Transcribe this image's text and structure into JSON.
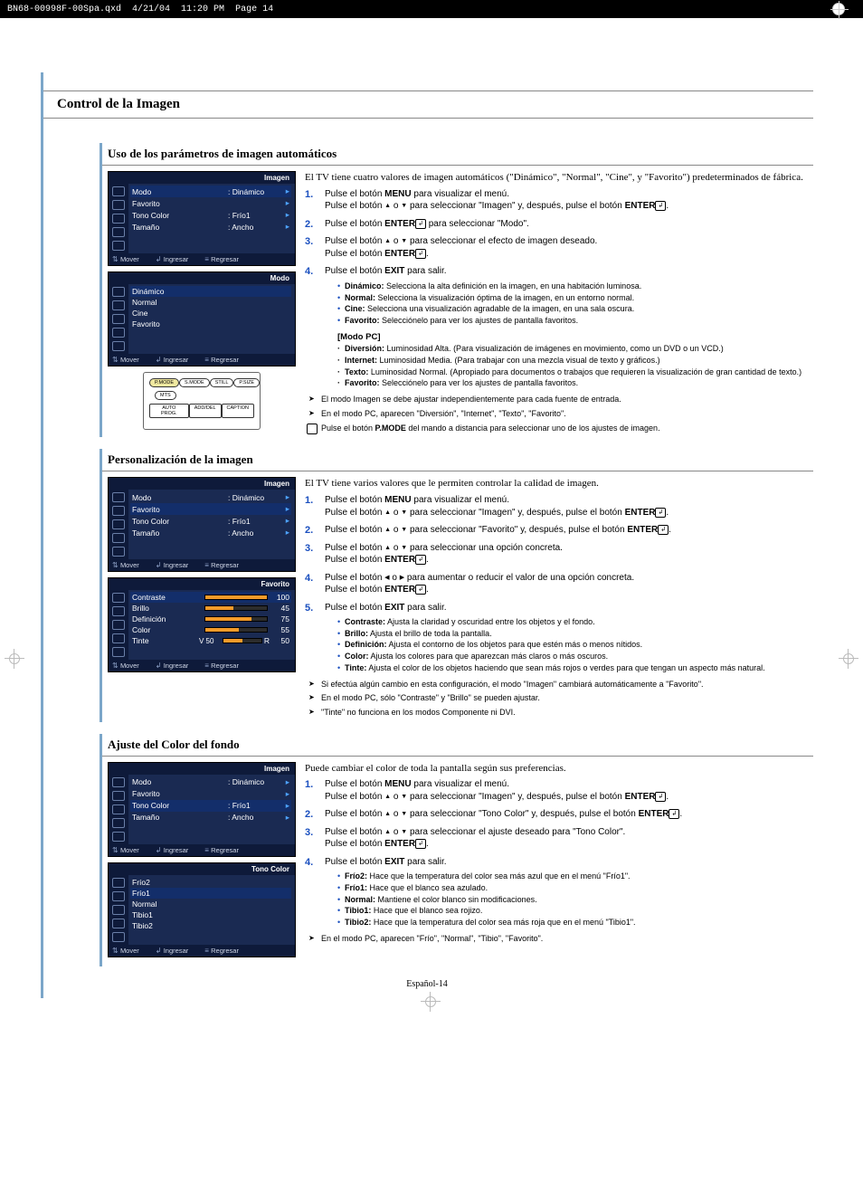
{
  "header": {
    "file": "BN68-00998F-00Spa.qxd",
    "date": "4/21/04",
    "time": "11:20 PM",
    "page_label": "Page 14"
  },
  "main_title": "Control de la Imagen",
  "page_number": "Español-14",
  "osd_common": {
    "imagen_title": "Imagen",
    "mover": "Mover",
    "ingresar": "Ingresar",
    "regresar": "Regresar",
    "rows": {
      "modo": "Modo",
      "modo_val": ":  Dinámico",
      "favorito": "Favorito",
      "tono": "Tono Color",
      "tono_val": ":  Frío1",
      "tamano": "Tamaño",
      "tamano_val": ":  Ancho"
    }
  },
  "s1": {
    "heading": "Uso de los parámetros de imagen automáticos",
    "osd_modo_title": "Modo",
    "modo_items": [
      "Dinámico",
      "Normal",
      "Cine",
      "Favorito"
    ],
    "intro": "El TV tiene cuatro valores de imagen automáticos (\"Dinámico\", \"Normal\", \"Cine\", y \"Favorito\") predeterminados de fábrica.",
    "step1a": "Pulse el botón ",
    "step1b_kw": "MENU",
    "step1c": " para visualizar el menú.",
    "step1d": "Pulse el botón ",
    "step1e": " o ",
    "step1f": " para seleccionar \"Imagen\" y, después, pulse el botón ",
    "step1g_kw": "ENTER",
    "step1h": ".",
    "step2a": "Pulse el botón ",
    "step2b_kw": "ENTER",
    "step2c": " para seleccionar \"Modo\".",
    "step3a": "Pulse el botón ",
    "step3b": " o ",
    "step3c": " para seleccionar el efecto de imagen deseado.",
    "step3d": "Pulse el botón ",
    "step3e_kw": "ENTER",
    "step3f": ".",
    "step4a": "Pulse el botón ",
    "step4b_kw": "EXIT",
    "step4c": " para salir.",
    "def": [
      {
        "t": "Dinámico:",
        "d": " Selecciona la alta definición en la imagen, en una habitación luminosa."
      },
      {
        "t": "Normal:",
        "d": " Selecciona la visualización óptima de la imagen, en un entorno normal."
      },
      {
        "t": "Cine:",
        "d": " Selecciona una visualización agradable de la imagen, en una sala oscura."
      },
      {
        "t": "Favorito:",
        "d": " Selecciónelo para ver los ajustes de pantalla favoritos."
      }
    ],
    "modo_pc_hdr": "[Modo PC]",
    "pc_items": [
      {
        "t": "Diversión:",
        "d": " Luminosidad Alta. (Para visualización de imágenes en movimiento, como un DVD o un VCD.)"
      },
      {
        "t": "Internet:",
        "d": " Luminosidad Media. (Para trabajar con una mezcla visual de texto y gráficos.)"
      },
      {
        "t": "Texto:",
        "d": " Luminosidad Normal. (Apropiado para documentos o trabajos que requieren la visualización de gran cantidad de texto.)"
      },
      {
        "t": "Favorito:",
        "d": " Selecciónelo para ver los ajustes de pantalla favoritos."
      }
    ],
    "note1": "El modo Imagen se debe ajustar independientemente para cada fuente de entrada.",
    "note2": "En el modo PC, aparecen \"Diversión\", \"Internet\", \"Texto\", \"Favorito\".",
    "hand_a": "Pulse el botón ",
    "hand_kw": "P.MODE",
    "hand_b": " del mando a distancia para seleccionar uno de los ajustes de imagen.",
    "remote_btns": {
      "r1": [
        "P.MODE",
        "S.MODE",
        "STILL",
        "P.SIZE"
      ],
      "r2": [
        "MTS"
      ],
      "r3": [
        "AUTO PROG.",
        "ADD/DEL",
        "CAPTION"
      ]
    }
  },
  "s2": {
    "heading": "Personalización de la imagen",
    "osd_fav_title": "Favorito",
    "sliders": [
      {
        "name": "Contraste",
        "val": "100",
        "fill": 100
      },
      {
        "name": "Brillo",
        "val": "45",
        "fill": 45
      },
      {
        "name": "Definición",
        "val": "75",
        "fill": 75
      },
      {
        "name": "Color",
        "val": "55",
        "fill": 55
      },
      {
        "name": "Tinte",
        "prefix": "V  50",
        "val": "50",
        "suffix": "R",
        "fill": 50
      }
    ],
    "intro": "El TV tiene varios valores que le permiten controlar la calidad de imagen.",
    "step2": "Pulse el botón ▲ o ▼ para seleccionar \"Favorito\" y, después, pulse el botón ENTER.",
    "step3a": "Pulse el botón ",
    "step3b": " o ",
    "step3c": " para seleccionar una opción concreta.",
    "step4a": "Pulse el botón ",
    "step4b": " o ",
    "step4c": " para aumentar o reducir el valor de una opción concreta.",
    "step5a": "Pulse el botón ",
    "step5b_kw": "EXIT",
    "step5c": " para salir.",
    "defs": [
      {
        "t": "Contraste:",
        "d": " Ajusta la claridad y oscuridad entre los objetos y el fondo."
      },
      {
        "t": "Brillo:",
        "d": " Ajusta el brillo de toda la pantalla."
      },
      {
        "t": "Definición:",
        "d": " Ajusta el contorno de los objetos para que estén más o menos nítidos."
      },
      {
        "t": "Color:",
        "d": " Ajusta los colores para que aparezcan más claros o más oscuros."
      },
      {
        "t": "Tinte:",
        "d": " Ajusta el color de los objetos haciendo que sean más rojos o verdes para que tengan un aspecto más natural."
      }
    ],
    "note1": "Si efectúa algún cambio en esta configuración, el modo \"Imagen\" cambiará automáticamente a \"Favorito\".",
    "note2": "En el modo PC, sólo \"Contraste\" y \"Brillo\" se pueden ajustar.",
    "note3": "\"Tinte\" no funciona en los modos Componente ni DVI."
  },
  "s3": {
    "heading": "Ajuste del Color del fondo",
    "osd_tono_title": "Tono Color",
    "tono_items": [
      "Frío2",
      "Frío1",
      "Normal",
      "Tibio1",
      "Tibio2"
    ],
    "intro": "Puede cambiar el color de toda la pantalla según sus preferencias.",
    "step2": "Pulse el botón ▲ o ▼ para seleccionar \"Tono Color\" y, después, pulse el botón ENTER.",
    "step3a": "Pulse el botón ",
    "step3b": " o ",
    "step3c": " para seleccionar el ajuste deseado para \"Tono Color\".",
    "step4a": "Pulse el botón ",
    "step4b_kw": "EXIT",
    "step4c": " para salir.",
    "defs": [
      {
        "t": "Frío2:",
        "d": " Hace que la temperatura del color sea más azul que en el menú \"Frío1\"."
      },
      {
        "t": "Frío1:",
        "d": " Hace que el blanco sea azulado."
      },
      {
        "t": "Normal:",
        "d": " Mantiene el color blanco sin modificaciones."
      },
      {
        "t": "Tibio1:",
        "d": " Hace que el blanco sea rojizo."
      },
      {
        "t": "Tibio2:",
        "d": " Hace que la temperatura del color sea más roja que en el menú \"Tibio1\"."
      }
    ],
    "note1": "En el modo PC, aparecen \"Frío\", \"Normal\", \"Tibio\", \"Favorito\"."
  }
}
